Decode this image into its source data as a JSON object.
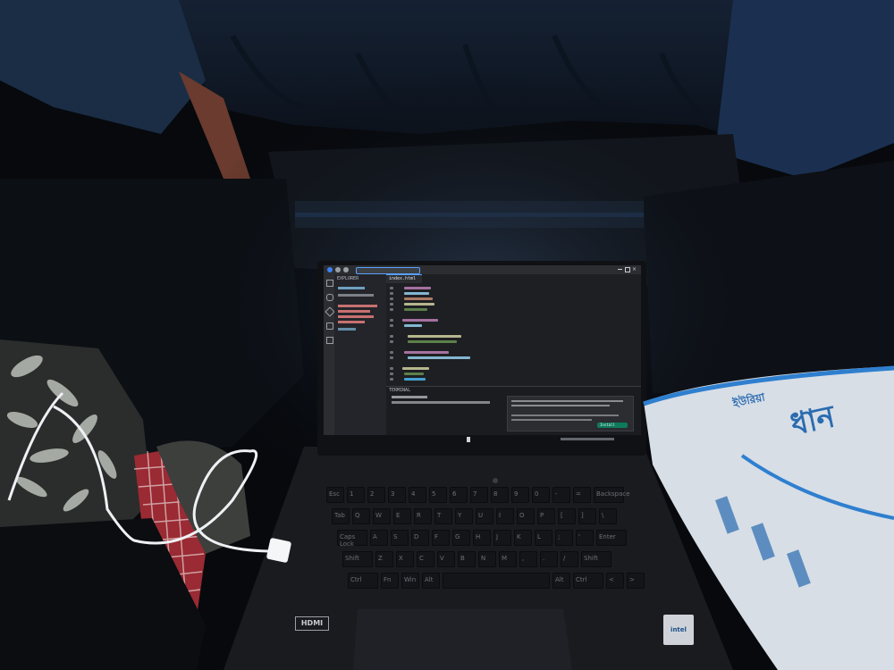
{
  "scene": {
    "description_label": "Laptop on lap in dark vehicle",
    "colors": {
      "curtain": "#1b2a3c",
      "seat": "#0f1217",
      "screen_bg": "#1e1f22",
      "bag": "#dfe5ec",
      "bag_text": "#2a6bb0",
      "cable": "#f2f4f6"
    }
  },
  "laptop": {
    "brand_label": "hdmi",
    "hdmi_label": "HDMI",
    "sticker_label": "intel"
  },
  "editor": {
    "explorer_title": "EXPLORER",
    "tab_label": "index.html",
    "terminal_label": "TERMINAL",
    "toast_button": "Install",
    "icons": [
      "files-icon",
      "search-icon",
      "source-control-icon",
      "debug-icon",
      "extensions-icon"
    ]
  },
  "keyboard": {
    "row1": [
      "Esc",
      "1",
      "2",
      "3",
      "4",
      "5",
      "6",
      "7",
      "8",
      "9",
      "0",
      "-",
      "=",
      "Backspace"
    ],
    "row2": [
      "Tab",
      "Q",
      "W",
      "E",
      "R",
      "T",
      "Y",
      "U",
      "I",
      "O",
      "P",
      "[",
      "]",
      "\\"
    ],
    "row3": [
      "Caps Lock",
      "A",
      "S",
      "D",
      "F",
      "G",
      "H",
      "J",
      "K",
      "L",
      ";",
      "'",
      "Enter"
    ],
    "row4": [
      "Shift",
      "Z",
      "X",
      "C",
      "V",
      "B",
      "N",
      "M",
      ",",
      ".",
      "/",
      "Shift"
    ],
    "row5": [
      "Ctrl",
      "Fn",
      "Win",
      "Alt",
      "",
      "Alt",
      "Ctrl",
      "<",
      ">"
    ]
  }
}
